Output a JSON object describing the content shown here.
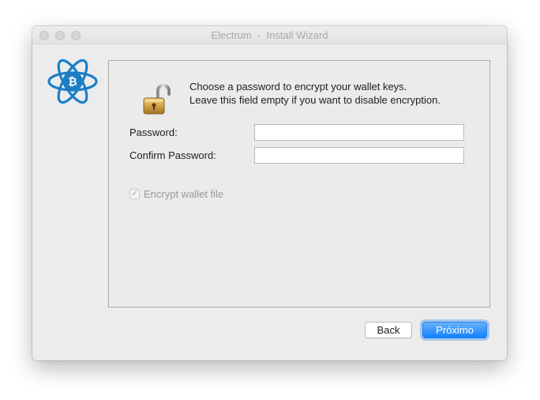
{
  "window": {
    "title": "Electrum  -  Install Wizard"
  },
  "icons": {
    "logo": "electrum-logo-icon",
    "lock": "open-padlock-icon",
    "check": "checkmark-icon"
  },
  "colors": {
    "logo_blue": "#1b7fc6",
    "accent_button": "#0d81ff",
    "window_bg": "#ececec"
  },
  "message": {
    "line1": "Choose a password to encrypt your wallet keys.",
    "line2": "Leave this field empty if you want to disable encryption."
  },
  "form": {
    "password_label": "Password:",
    "password_value": "",
    "confirm_label": "Confirm Password:",
    "confirm_value": "",
    "encrypt_label": "Encrypt wallet file",
    "encrypt_checked": true,
    "check_glyph": "✓"
  },
  "buttons": {
    "back": "Back",
    "next": "Próximo"
  }
}
